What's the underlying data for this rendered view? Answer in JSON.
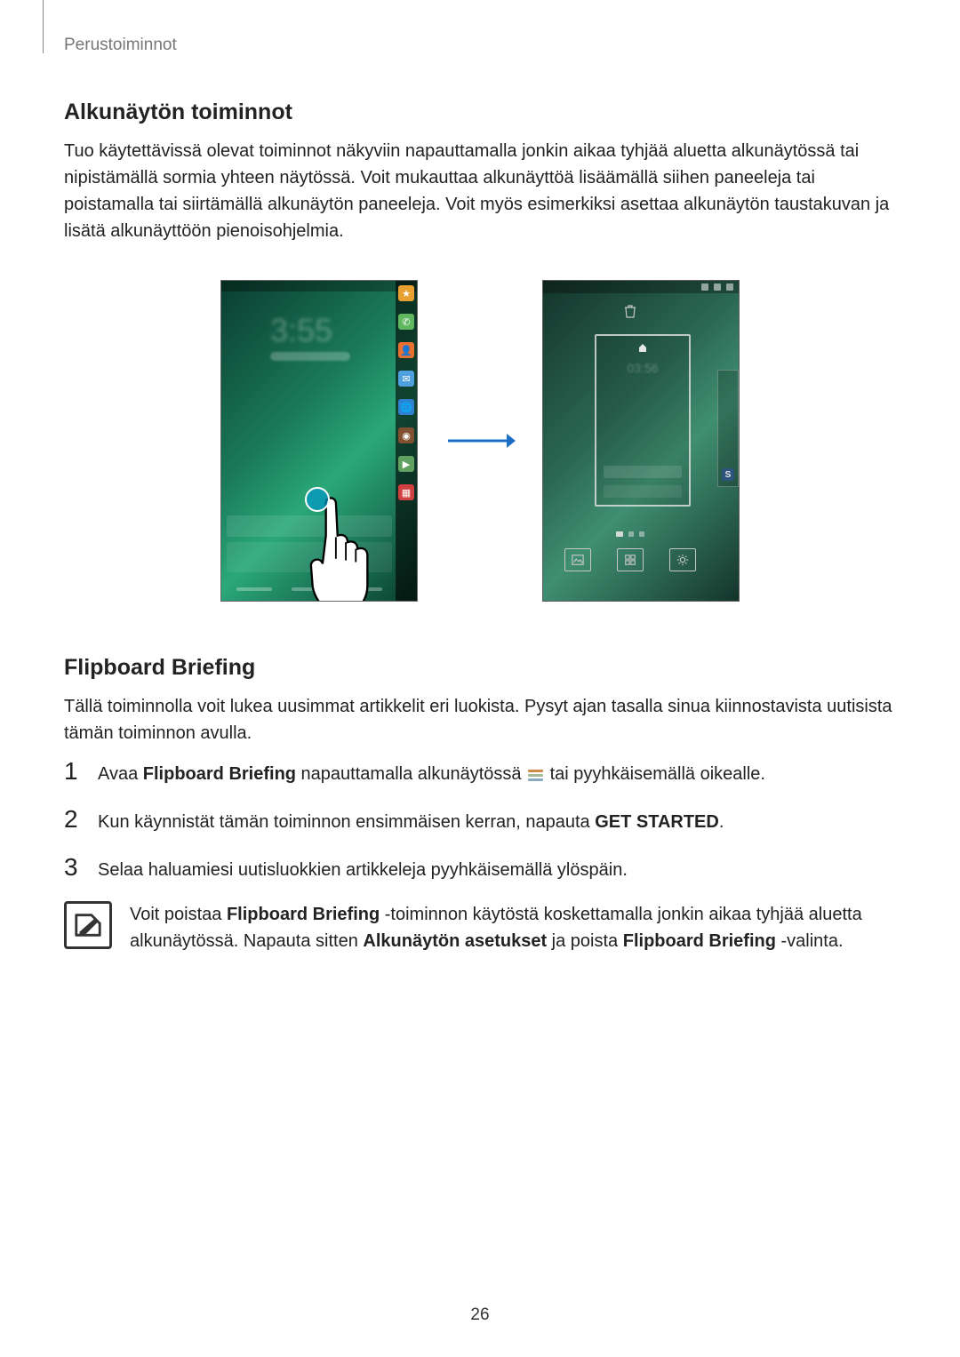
{
  "section_label": "Perustoiminnot",
  "h1": "Alkunäytön toiminnot",
  "p1": "Tuo käytettävissä olevat toiminnot näkyviin napauttamalla jonkin aikaa tyhjää aluetta alkunäytössä tai nipistämällä sormia yhteen näytössä. Voit mukauttaa alkunäyttöä lisäämällä siihen paneeleja tai poistamalla tai siirtämällä alkunäytön paneeleja. Voit myös esimerkiksi asettaa alkunäytön taustakuvan ja lisätä alkunäyttöön pienoisohjelmia.",
  "h2": "Flipboard Briefing",
  "p2": "Tällä toiminnolla voit lukea uusimmat artikkelit eri luokista. Pysyt ajan tasalla sinua kiinnostavista uutisista tämän toiminnon avulla.",
  "steps": {
    "s1_num": "1",
    "s1_pre": "Avaa ",
    "s1_bold": "Flipboard Briefing",
    "s1_mid": " napauttamalla alkunäytössä ",
    "s1_post": " tai pyyhkäisemällä oikealle.",
    "s2_num": "2",
    "s2_pre": "Kun käynnistät tämän toiminnon ensimmäisen kerran, napauta ",
    "s2_bold": "GET STARTED",
    "s2_post": ".",
    "s3_num": "3",
    "s3_text": "Selaa haluamiesi uutisluokkien artikkeleja pyyhkäisemällä ylöspäin."
  },
  "note": {
    "pre": "Voit poistaa ",
    "b1": "Flipboard Briefing",
    "mid1": " -toiminnon käytöstä koskettamalla jonkin aikaa tyhjää aluetta alkunäytössä. Napauta sitten ",
    "b2": "Alkunäytön asetukset",
    "mid2": " ja poista ",
    "b3": "Flipboard Briefing",
    "post": " -valinta."
  },
  "page_number": "26"
}
